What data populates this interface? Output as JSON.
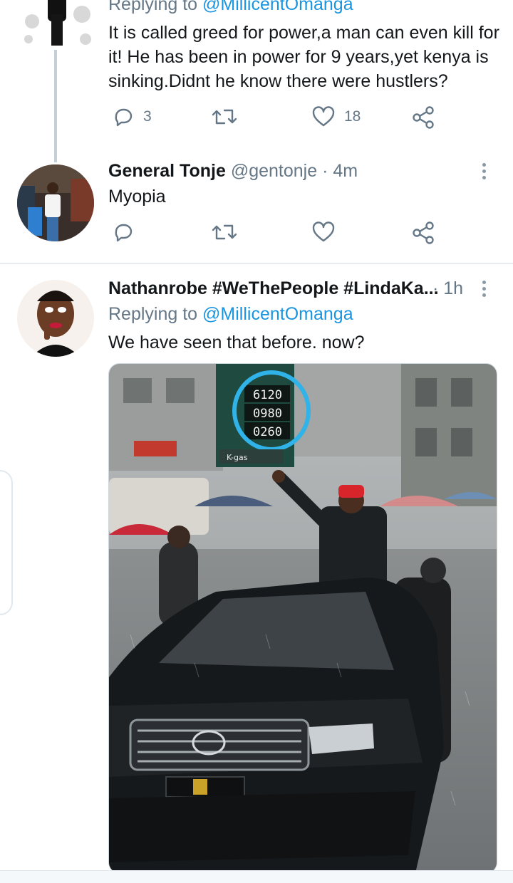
{
  "tweets": [
    {
      "replying_prefix": "Replying to ",
      "replying_to": "@MillicentOmanga",
      "text": "It is called greed for power,a man can even kill for it! He has been in power for 9 years,yet kenya is sinking.Didnt he know there were hustlers?",
      "replies": "3",
      "likes": "18"
    },
    {
      "name": "General Tonje",
      "handle": "@gentonje",
      "dot": "·",
      "time": "4m",
      "text": "Myopia"
    },
    {
      "name": "Nathanrobe #WeThePeople #LindaKa...",
      "dot": "·",
      "time": "1h",
      "replying_prefix": "Replying to ",
      "replying_to": "@MillicentOmanga",
      "text": "We have seen that before. now?",
      "media": {
        "fuel_prices": [
          "6120",
          "0980",
          "0260"
        ],
        "station_sign": "K-gas"
      }
    }
  ],
  "icons": {
    "reply": "reply-icon",
    "retweet": "retweet-icon",
    "like": "like-icon",
    "share": "share-icon",
    "more": "more-icon"
  },
  "colors": {
    "link": "#1b95e0",
    "secondary": "#657786",
    "divider": "#e6ecf0"
  }
}
